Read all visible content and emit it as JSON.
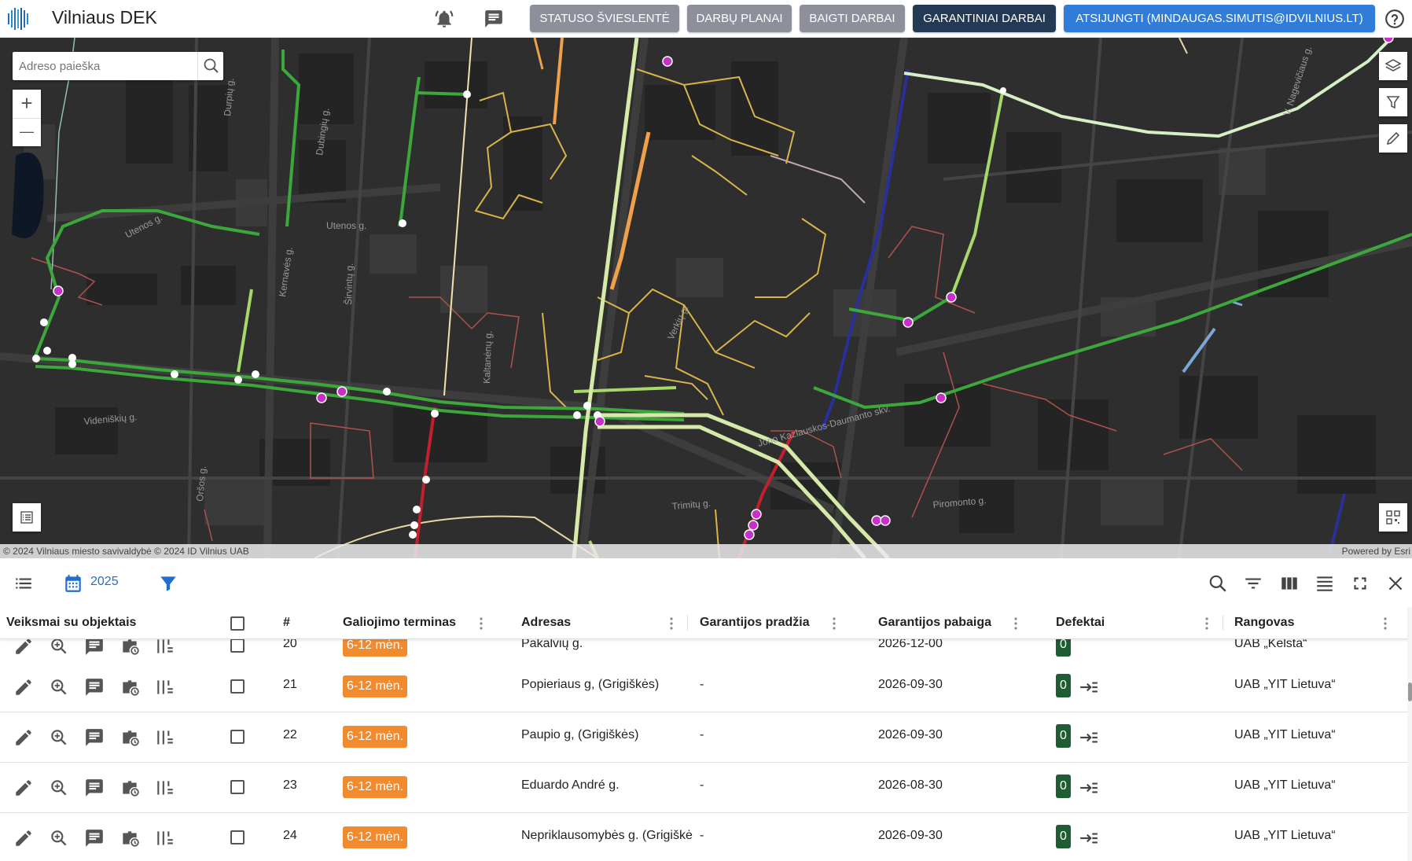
{
  "header": {
    "title": "Vilniaus DEK",
    "buttons": {
      "statuso": "STATUSO ŠVIESLENTĖ",
      "darbu_planai": "DARBŲ PLANAI",
      "baigti_darbai": "BAIGTI DARBAI",
      "garantiniai": "GARANTINIAI DARBAI",
      "atsijungti": "ATSIJUNGTI (MINDAUGAS.SIMUTIS@IDVILNIUS.LT)"
    }
  },
  "map": {
    "search_placeholder": "Adreso paieška",
    "zoom_in": "+",
    "zoom_out": "—",
    "attribution_left": "© 2024 Vilniaus miesto savivaldybė © 2024 ID Vilnius UAB",
    "attribution_right": "Powered by Esri",
    "street_labels": {
      "utenos1": "Utenos g.",
      "utenos2": "Utenos g.",
      "videniskiu": "Videniškių g.",
      "kazlauskos": "Jono Kazlauskos-Daumanto skv.",
      "trimitu": "Trimitų g.",
      "piromonto": "Piromonto g.",
      "nagevicius": "V. Nagevičiaus g.",
      "dubingiu": "Dubingių g.",
      "komaves": "Kernavės g.",
      "sirvintu": "Širvintų g.",
      "kaltanenu": "Kaltanėnų g.",
      "verkiu": "Verkių g.",
      "durpiu": "Durpių g.",
      "orsos": "Oršos g."
    }
  },
  "toolbar": {
    "year": "2025"
  },
  "table": {
    "columns": {
      "actions": "Veiksmai su objektais",
      "num": "#",
      "term": "Galiojimo terminas",
      "address": "Adresas",
      "start": "Garantijos pradžia",
      "end": "Garantijos pabaiga",
      "defects": "Defektai",
      "contractor": "Rangovas"
    },
    "rows": [
      {
        "num": "20",
        "term": "6-12 mėn.",
        "address": "Pakalvių g.",
        "start": "-",
        "end": "2026-12-00",
        "defects": "0",
        "contractor": "UAB „Kelsta“"
      },
      {
        "num": "21",
        "term": "6-12 mėn.",
        "address": "Popieriaus g, (Grigiškės)",
        "start": "-",
        "end": "2026-09-30",
        "defects": "0",
        "contractor": "UAB „YIT Lietuva“"
      },
      {
        "num": "22",
        "term": "6-12 mėn.",
        "address": "Paupio g, (Grigiškės)",
        "start": "-",
        "end": "2026-09-30",
        "defects": "0",
        "contractor": "UAB „YIT Lietuva“"
      },
      {
        "num": "23",
        "term": "6-12 mėn.",
        "address": "Eduardo André g.",
        "start": "-",
        "end": "2026-08-30",
        "defects": "0",
        "contractor": "UAB „YIT Lietuva“"
      },
      {
        "num": "24",
        "term": "6-12 mėn.",
        "address": "Nepriklausomybės g. (Grigiškės)",
        "start": "-",
        "end": "2026-09-30",
        "defects": "0",
        "contractor": "UAB „YIT Lietuva“"
      }
    ]
  }
}
